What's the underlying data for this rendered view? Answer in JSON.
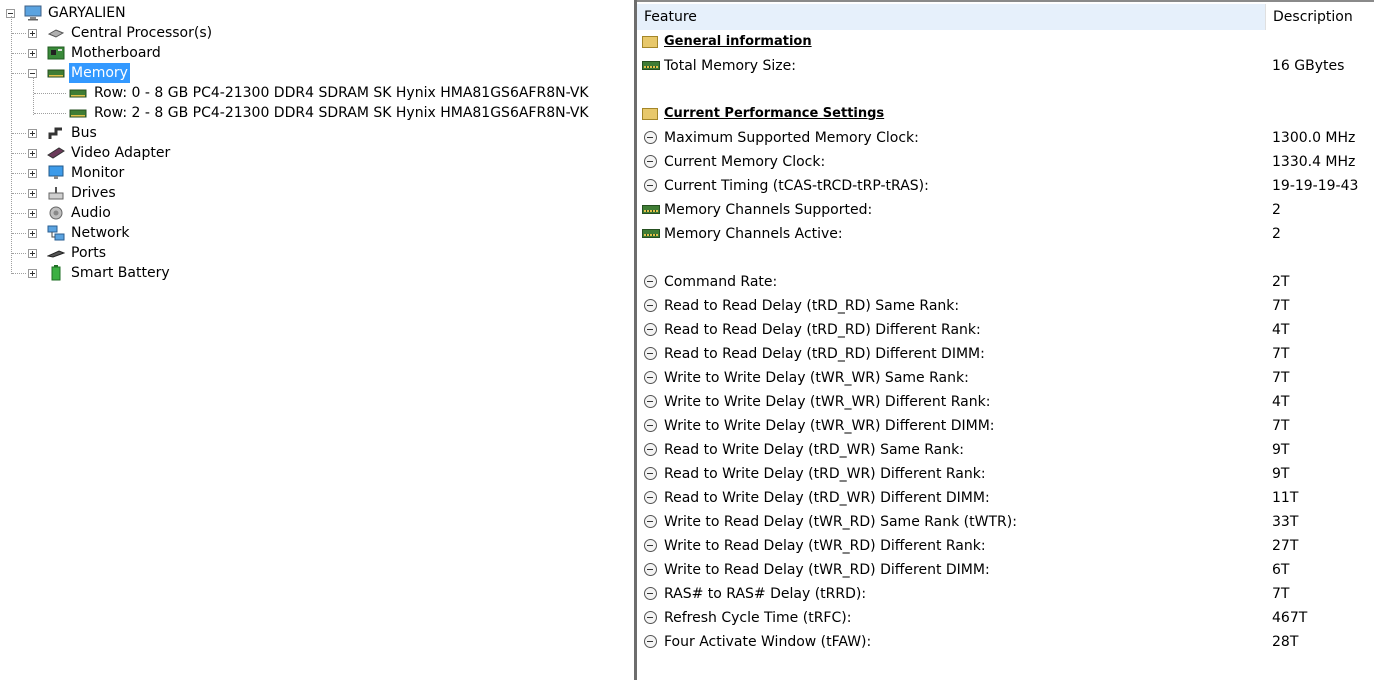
{
  "tree": {
    "root": "GARYALIEN",
    "items": [
      {
        "label": "Central Processor(s)",
        "icon": "cpu-icon"
      },
      {
        "label": "Motherboard",
        "icon": "motherboard-icon"
      },
      {
        "label": "Memory",
        "icon": "memory-icon",
        "selected": true,
        "children": [
          {
            "label": "Row: 0 - 8 GB PC4-21300 DDR4 SDRAM SK Hynix HMA81GS6AFR8N-VK"
          },
          {
            "label": "Row: 2 - 8 GB PC4-21300 DDR4 SDRAM SK Hynix HMA81GS6AFR8N-VK"
          }
        ]
      },
      {
        "label": "Bus",
        "icon": "bus-icon"
      },
      {
        "label": "Video Adapter",
        "icon": "video-adapter-icon"
      },
      {
        "label": "Monitor",
        "icon": "monitor-icon"
      },
      {
        "label": "Drives",
        "icon": "drive-icon"
      },
      {
        "label": "Audio",
        "icon": "audio-icon"
      },
      {
        "label": "Network",
        "icon": "network-icon"
      },
      {
        "label": "Ports",
        "icon": "ports-icon"
      },
      {
        "label": "Smart Battery",
        "icon": "battery-icon"
      }
    ]
  },
  "list": {
    "headers": {
      "feature": "Feature",
      "description": "Description"
    },
    "rows": [
      {
        "type": "section",
        "feature": "General information",
        "value": ""
      },
      {
        "type": "ram",
        "feature": "Total Memory Size:",
        "value": "16 GBytes"
      },
      {
        "type": "blank",
        "feature": "",
        "value": ""
      },
      {
        "type": "section",
        "feature": "Current Performance Settings",
        "value": ""
      },
      {
        "type": "clock",
        "feature": "Maximum Supported Memory Clock:",
        "value": "1300.0 MHz"
      },
      {
        "type": "clock",
        "feature": "Current Memory Clock:",
        "value": "1330.4 MHz"
      },
      {
        "type": "clock",
        "feature": "Current Timing (tCAS-tRCD-tRP-tRAS):",
        "value": "19-19-19-43"
      },
      {
        "type": "ram",
        "feature": "Memory Channels Supported:",
        "value": "2"
      },
      {
        "type": "ram",
        "feature": "Memory Channels Active:",
        "value": "2"
      },
      {
        "type": "blank",
        "feature": "",
        "value": ""
      },
      {
        "type": "clock",
        "feature": "Command Rate:",
        "value": "2T"
      },
      {
        "type": "clock",
        "feature": "Read to Read Delay (tRD_RD) Same Rank:",
        "value": "7T"
      },
      {
        "type": "clock",
        "feature": "Read to Read Delay (tRD_RD) Different Rank:",
        "value": "4T"
      },
      {
        "type": "clock",
        "feature": "Read to Read Delay (tRD_RD) Different DIMM:",
        "value": "7T"
      },
      {
        "type": "clock",
        "feature": "Write to Write Delay (tWR_WR) Same Rank:",
        "value": "7T"
      },
      {
        "type": "clock",
        "feature": "Write to Write Delay (tWR_WR) Different Rank:",
        "value": "4T"
      },
      {
        "type": "clock",
        "feature": "Write to Write Delay (tWR_WR) Different DIMM:",
        "value": "7T"
      },
      {
        "type": "clock",
        "feature": "Read to Write Delay (tRD_WR) Same Rank:",
        "value": "9T"
      },
      {
        "type": "clock",
        "feature": "Read to Write Delay (tRD_WR) Different Rank:",
        "value": "9T"
      },
      {
        "type": "clock",
        "feature": "Read to Write Delay (tRD_WR) Different DIMM:",
        "value": "11T"
      },
      {
        "type": "clock",
        "feature": "Write to Read Delay (tWR_RD) Same Rank (tWTR):",
        "value": "33T"
      },
      {
        "type": "clock",
        "feature": "Write to Read Delay (tWR_RD) Different Rank:",
        "value": "27T"
      },
      {
        "type": "clock",
        "feature": "Write to Read Delay (tWR_RD) Different DIMM:",
        "value": "6T"
      },
      {
        "type": "clock",
        "feature": "RAS# to RAS# Delay (tRRD):",
        "value": "7T"
      },
      {
        "type": "clock",
        "feature": "Refresh Cycle Time (tRFC):",
        "value": "467T"
      },
      {
        "type": "clock",
        "feature": "Four Activate Window (tFAW):",
        "value": "28T"
      }
    ]
  }
}
